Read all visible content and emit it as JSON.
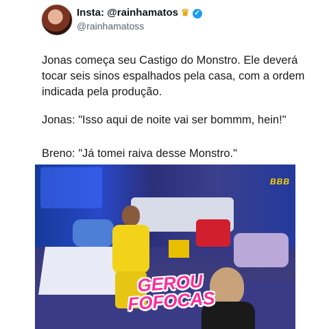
{
  "header": {
    "name": "Insta: @rainhamatos",
    "crown_icon": "crown-icon",
    "verified_icon": "verified-badge-icon",
    "handle": "@rainhamatoss"
  },
  "post": {
    "paragraph1": "Jonas começa seu Castigo do Monstro. Ele deverá tocar seis sinos espalhados pela casa, com a ordem indicada pela produção.",
    "paragraph2": "Jonas: \"Isso aqui de noite vai ser bommm, hein!\"",
    "paragraph3": "Breno: \"Já tomei raiva desse Monstro.\""
  },
  "media": {
    "bbb_logo": "BBB",
    "overlay_line1": "GEROU",
    "overlay_line2": "FOFOCAS"
  },
  "colors": {
    "verified": "#1d9bf0",
    "overlay_text": "#ff2d9a",
    "shirt": "#f3d31a"
  }
}
